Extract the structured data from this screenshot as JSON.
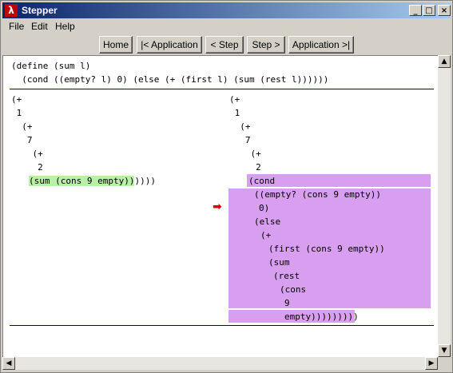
{
  "window": {
    "title": "Stepper",
    "min_label": "_",
    "max_label": "□",
    "close_label": "×",
    "icon_glyph": "λ"
  },
  "menu": {
    "file": "File",
    "edit": "Edit",
    "help": "Help"
  },
  "toolbar": {
    "home": "Home",
    "prev_app": "|< Application",
    "prev_step": "< Step",
    "next_step": "Step >",
    "next_app": "Application >|"
  },
  "definition": {
    "line1": "(define (sum l)",
    "line2": "  (cond ((empty? l) 0) (else (+ (first l) (sum (rest l))))))"
  },
  "left_expr": {
    "l1": "(+",
    "l2": " 1",
    "l3": "  (+",
    "l4": "   7",
    "l5": "    (+",
    "l6": "     2",
    "l7_highlight": "(sum (cons 9 empty))",
    "l7_tail": "))))"
  },
  "right_expr": {
    "l1": "(+",
    "l2": " 1",
    "l3": "  (+",
    "l4": "   7",
    "l5": "    (+",
    "l6": "     2",
    "l7": "(cond",
    "l8": "((empty? (cons 9 empty))",
    "l9": "0)",
    "l10": "(else",
    "l11": "(+",
    "l12": "(first (cons 9 empty))",
    "l13": "(sum",
    "l14": "(rest",
    "l15": "(cons",
    "l16": "9",
    "l17_highlight": "empty))))))",
    "l17_tail": ")))"
  },
  "colors": {
    "green_highlight": "#b8f0a8",
    "purple_highlight": "#d89ef0",
    "arrow": "#e00000",
    "rule": "#000080"
  }
}
